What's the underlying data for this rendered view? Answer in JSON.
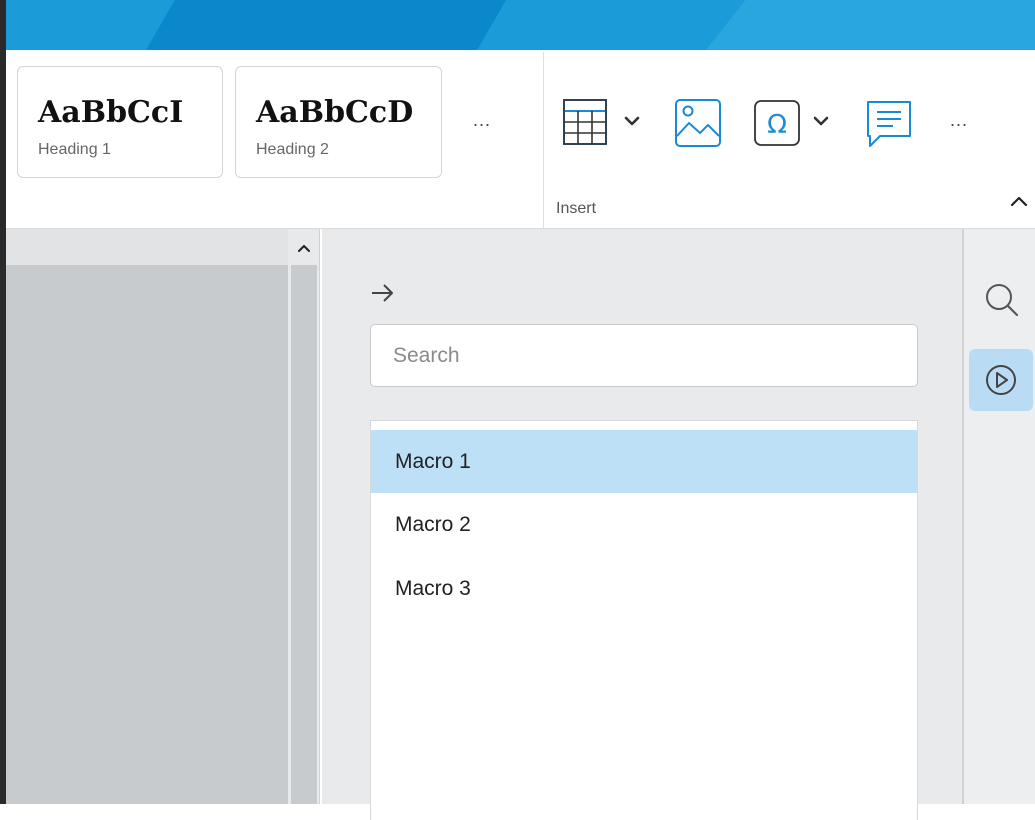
{
  "ribbon": {
    "styles": [
      {
        "preview": "AaBbCcI",
        "name": "Heading 1"
      },
      {
        "preview": "AaBbCcD",
        "name": "Heading 2"
      }
    ],
    "more_styles": "...",
    "insert": {
      "label": "Insert",
      "more": "...",
      "tools": [
        "table-icon",
        "image-icon",
        "special-character-icon",
        "comment-icon"
      ]
    }
  },
  "macros_panel": {
    "search_placeholder": "Search",
    "items": [
      "Macro 1",
      "Macro 2",
      "Macro 3"
    ],
    "selected_index": 0
  },
  "side_rail": {
    "buttons": [
      "search-icon",
      "macros-play-icon"
    ],
    "active": "macros-play-icon"
  },
  "colors": {
    "titlebar": "#1b9bd8",
    "selection": "#bde0f6",
    "accent_icon": "#1a8ad4"
  }
}
